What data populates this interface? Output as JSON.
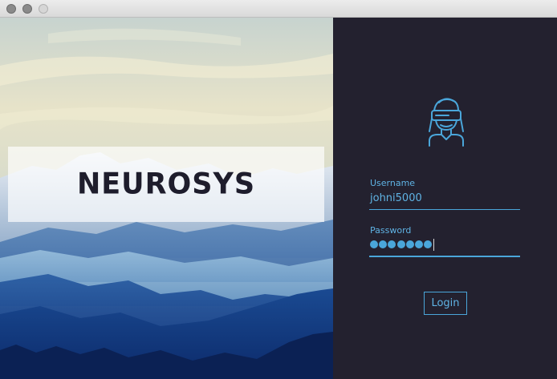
{
  "window": {
    "controls": [
      "close",
      "minimize",
      "maximize"
    ]
  },
  "brand": {
    "name": "NEUROSYS"
  },
  "login": {
    "avatar_icon": "vr-headset-user-icon",
    "username_label": "Username",
    "username_value": "johni5000",
    "password_label": "Password",
    "password_dot_count": 7,
    "login_button": "Login"
  },
  "colors": {
    "accent": "#4aa6da",
    "panel_background": "#23212f",
    "brand_text": "#1e1d2c"
  }
}
